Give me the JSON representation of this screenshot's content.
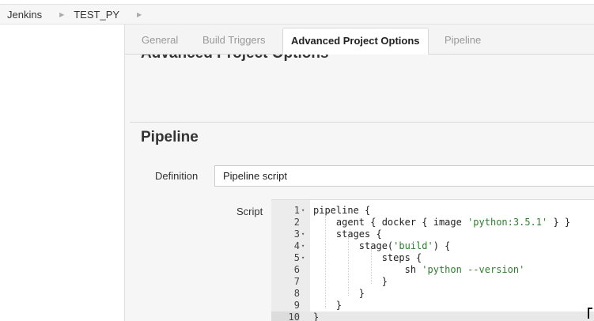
{
  "breadcrumb": {
    "items": [
      {
        "label": "Jenkins"
      },
      {
        "label": "TEST_PY"
      }
    ]
  },
  "tabs": [
    {
      "label": "General",
      "active": false
    },
    {
      "label": "Build Triggers",
      "active": false
    },
    {
      "label": "Advanced Project Options",
      "active": true
    },
    {
      "label": "Pipeline",
      "active": false
    }
  ],
  "sections": {
    "advanced_title": "Advanced Project Options",
    "pipeline_title": "Pipeline"
  },
  "pipeline": {
    "definition_label": "Definition",
    "definition_value": "Pipeline script",
    "script_label": "Script"
  },
  "editor": {
    "lines": [
      {
        "number": "1",
        "fold": "▾",
        "code": "pipeline {"
      },
      {
        "number": "2",
        "fold": "",
        "code": "    agent { docker { image 'python:3.5.1' } }"
      },
      {
        "number": "3",
        "fold": "▾",
        "code": "    stages {"
      },
      {
        "number": "4",
        "fold": "▾",
        "code": "        stage('build') {"
      },
      {
        "number": "5",
        "fold": "▾",
        "code": "            steps {"
      },
      {
        "number": "6",
        "fold": "",
        "code": "                sh 'python --version'"
      },
      {
        "number": "7",
        "fold": "",
        "code": "            }"
      },
      {
        "number": "8",
        "fold": "",
        "code": "        }"
      },
      {
        "number": "9",
        "fold": "",
        "code": "    }"
      },
      {
        "number": "10",
        "fold": "",
        "code": "}"
      }
    ],
    "active_line": 10
  },
  "colors": {
    "string": "#2c7f2c",
    "tab_active_bg": "#ffffff",
    "content_bg": "#f6f6f6"
  }
}
